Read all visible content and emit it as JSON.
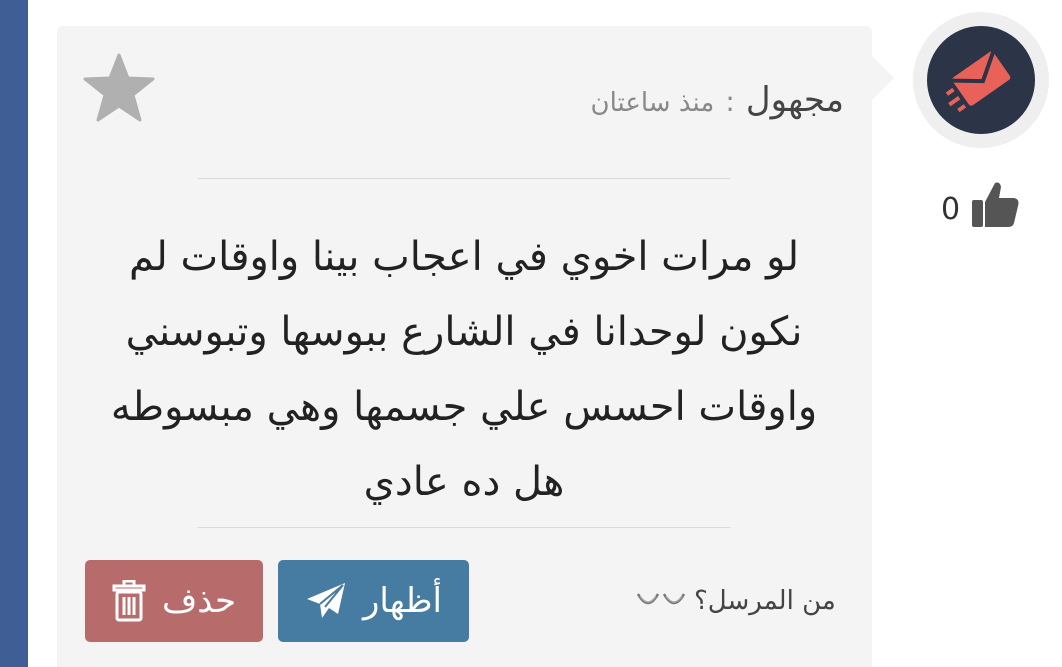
{
  "post": {
    "author_name": "مجهول",
    "separator": ":",
    "time_ago": "منذ ساعتان",
    "message": "لو مرات اخوي في اعجاب بينا واوقات لم نكون لوحدانا في الشارع ببوسها وتبوسني واوقات احسس علي جسمها وهي مبسوطه هل ده عادي",
    "like_count": "0"
  },
  "actions": {
    "reveal_label": "أظهار",
    "delete_label": "حذف",
    "sender_question": "من المرسل؟"
  },
  "colors": {
    "reveal_button": "#467ba2",
    "delete_button": "#b86b6b",
    "avatar_bg": "#2c3447",
    "avatar_icon": "#e8625a",
    "card_bg": "#f4f4f4",
    "side_bar": "#3f5e96"
  },
  "icons": {
    "avatar": "envelope-icon",
    "favorite": "star-icon",
    "like": "thumbs-up-icon",
    "reveal": "paper-plane-icon",
    "delete": "trash-icon",
    "sender": "eyes-icon"
  }
}
